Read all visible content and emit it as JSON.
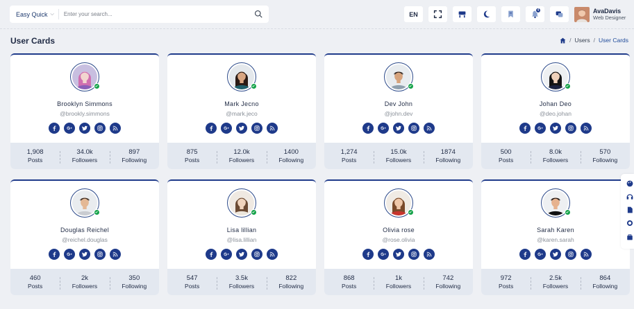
{
  "search": {
    "dropdown_label": "Easy Quick",
    "placeholder": "Enter your search..."
  },
  "header": {
    "language": "EN",
    "notification_count": "4"
  },
  "user": {
    "name": "AvaDavis",
    "role": "Web Designer"
  },
  "page": {
    "title": "User Cards"
  },
  "breadcrumb": {
    "items": [
      "Users",
      "User Cards"
    ]
  },
  "labels": {
    "posts": "Posts",
    "followers": "Followers",
    "following": "Following"
  },
  "colors": {
    "accent": "#1e3a8a",
    "online": "#16a34a",
    "stats_bg": "#e3e8f0"
  },
  "cards": [
    {
      "name": "Brooklyn Simmons",
      "handle": "@brookly.simmons",
      "posts": "1,908",
      "followers": "34.0k",
      "following": "897"
    },
    {
      "name": "Mark Jecno",
      "handle": "@mark.jeco",
      "posts": "875",
      "followers": "12.0k",
      "following": "1400"
    },
    {
      "name": "Dev John",
      "handle": "@john.dev",
      "posts": "1,274",
      "followers": "15.0k",
      "following": "1874"
    },
    {
      "name": "Johan Deo",
      "handle": "@deo.johan",
      "posts": "500",
      "followers": "8.0k",
      "following": "570"
    },
    {
      "name": "Douglas Reichel",
      "handle": "@reichel.douglas",
      "posts": "460",
      "followers": "2k",
      "following": "350"
    },
    {
      "name": "Lisa lillian",
      "handle": "@lisa.lillian",
      "posts": "547",
      "followers": "3.5k",
      "following": "822"
    },
    {
      "name": "Olivia rose",
      "handle": "@rose.olivia",
      "posts": "868",
      "followers": "1k",
      "following": "742"
    },
    {
      "name": "Sarah Karen",
      "handle": "@karen.sarah",
      "posts": "972",
      "followers": "2.5k",
      "following": "864"
    }
  ]
}
